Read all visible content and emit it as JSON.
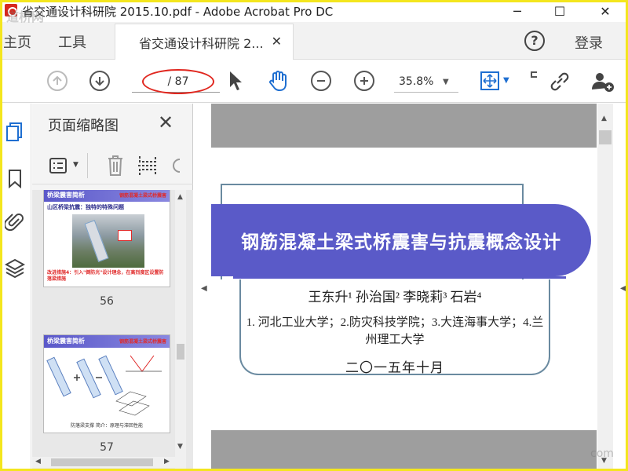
{
  "window": {
    "title": "省交通设计科研院 2015.10.pdf - Adobe Acrobat Pro DC",
    "minimize": "─",
    "maximize": "☐",
    "close": "✕"
  },
  "menu": {
    "home": "主页",
    "tools": "工具",
    "doc_tab": "省交通设计科研院 2...",
    "doc_tab_close": "✕",
    "help": "?",
    "login": "登录"
  },
  "toolbar": {
    "page_value": "",
    "page_total": "/ 87",
    "zoom": "35.8%",
    "icons": [
      "prev-page-icon",
      "next-page-icon",
      "select-cursor-icon",
      "hand-tool-icon",
      "zoom-out-icon",
      "zoom-in-icon",
      "fit-page-icon",
      "link-icon",
      "add-user-icon"
    ]
  },
  "rail": {
    "icons": [
      "page-thumbnails-icon",
      "bookmark-icon",
      "attachment-icon",
      "layers-icon"
    ]
  },
  "thumb_panel": {
    "title": "页面缩略图",
    "close": "✕",
    "thumbnails": [
      {
        "page": "56",
        "header": "桥梁震害简析",
        "subtitle": "山区桥梁抗震：独特的特殊问题"
      },
      {
        "page": "57",
        "header": "桥梁震害简析",
        "caption": "防落梁支撑 简介：原理与滞回性能"
      }
    ]
  },
  "slide": {
    "title": "钢筋混凝土梁式桥震害与抗震概念设计",
    "authors": "王东升¹  孙治国²  李晓莉³  石岩⁴",
    "affiliations": "1. 河北工业大学；2.防灾科技学院；3.大连海事大学；4.兰州理工大学",
    "date": "二〇一五年十月"
  },
  "watermarks": {
    "top_left": "道桥网",
    "bottom_right": "com"
  },
  "colors": {
    "banner": "#5a5ac8",
    "annotation_red": "#e0261e",
    "frame_yellow": "#f4e61e"
  }
}
